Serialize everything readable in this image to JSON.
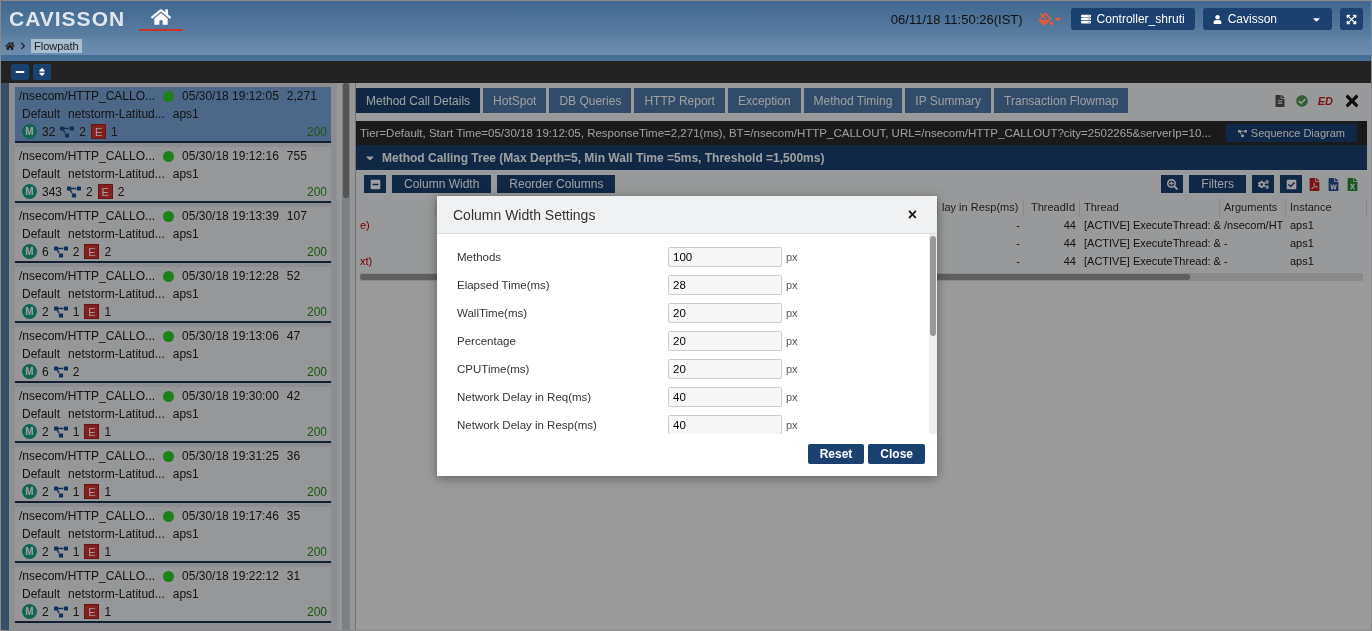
{
  "header": {
    "logo": "CAVISSON",
    "datetime": "06/11/18 11:50:26(IST)",
    "controller": "Controller_shruti",
    "user": "Cavisson"
  },
  "breadcrumb": {
    "current": "Flowpath"
  },
  "flowpaths": [
    {
      "url": "/nsecom/HTTP_CALLO...",
      "datetime": "05/30/18 19:12:05",
      "count": "2,271",
      "tier": "Default",
      "server": "netstorm-Latitud...",
      "instance": "aps1",
      "status": "200",
      "selected": true,
      "badges": [
        {
          "kind": "method",
          "label": "M",
          "count": "32"
        },
        {
          "kind": "tree",
          "count": "2"
        },
        {
          "kind": "exception",
          "label": "E",
          "count": "1"
        }
      ]
    },
    {
      "url": "/nsecom/HTTP_CALLO...",
      "datetime": "05/30/18 19:12:16",
      "count": "755",
      "tier": "Default",
      "server": "netstorm-Latitud...",
      "instance": "aps1",
      "status": "200",
      "selected": false,
      "badges": [
        {
          "kind": "method",
          "label": "M",
          "count": "343"
        },
        {
          "kind": "tree",
          "count": "2"
        },
        {
          "kind": "exception",
          "label": "E",
          "count": "2"
        }
      ]
    },
    {
      "url": "/nsecom/HTTP_CALLO...",
      "datetime": "05/30/18 19:13:39",
      "count": "107",
      "tier": "Default",
      "server": "netstorm-Latitud...",
      "instance": "aps1",
      "status": "200",
      "selected": false,
      "badges": [
        {
          "kind": "method",
          "label": "M",
          "count": "6"
        },
        {
          "kind": "tree",
          "count": "2"
        },
        {
          "kind": "exception",
          "label": "E",
          "count": "2"
        }
      ]
    },
    {
      "url": "/nsecom/HTTP_CALLO...",
      "datetime": "05/30/18 19:12:28",
      "count": "52",
      "tier": "Default",
      "server": "netstorm-Latitud...",
      "instance": "aps1",
      "status": "200",
      "selected": false,
      "badges": [
        {
          "kind": "method",
          "label": "M",
          "count": "2"
        },
        {
          "kind": "tree",
          "count": "1"
        },
        {
          "kind": "exception",
          "label": "E",
          "count": "1"
        }
      ]
    },
    {
      "url": "/nsecom/HTTP_CALLO...",
      "datetime": "05/30/18 19:13:06",
      "count": "47",
      "tier": "Default",
      "server": "netstorm-Latitud...",
      "instance": "aps1",
      "status": "200",
      "selected": false,
      "badges": [
        {
          "kind": "method",
          "label": "M",
          "count": "6"
        },
        {
          "kind": "tree",
          "count": "2"
        }
      ]
    },
    {
      "url": "/nsecom/HTTP_CALLO...",
      "datetime": "05/30/18 19:30:00",
      "count": "42",
      "tier": "Default",
      "server": "netstorm-Latitud...",
      "instance": "aps1",
      "status": "200",
      "selected": false,
      "badges": [
        {
          "kind": "method",
          "label": "M",
          "count": "2"
        },
        {
          "kind": "tree",
          "count": "1"
        },
        {
          "kind": "exception",
          "label": "E",
          "count": "1"
        }
      ]
    },
    {
      "url": "/nsecom/HTTP_CALLO...",
      "datetime": "05/30/18 19:31:25",
      "count": "36",
      "tier": "Default",
      "server": "netstorm-Latitud...",
      "instance": "aps1",
      "status": "200",
      "selected": false,
      "badges": [
        {
          "kind": "method",
          "label": "M",
          "count": "2"
        },
        {
          "kind": "tree",
          "count": "1"
        },
        {
          "kind": "exception",
          "label": "E",
          "count": "1"
        }
      ]
    },
    {
      "url": "/nsecom/HTTP_CALLO...",
      "datetime": "05/30/18 19:17:46",
      "count": "35",
      "tier": "Default",
      "server": "netstorm-Latitud...",
      "instance": "aps1",
      "status": "200",
      "selected": false,
      "badges": [
        {
          "kind": "method",
          "label": "M",
          "count": "2"
        },
        {
          "kind": "tree",
          "count": "1"
        },
        {
          "kind": "exception",
          "label": "E",
          "count": "1"
        }
      ]
    },
    {
      "url": "/nsecom/HTTP_CALLO...",
      "datetime": "05/30/18 19:22:12",
      "count": "31",
      "tier": "Default",
      "server": "netstorm-Latitud...",
      "instance": "aps1",
      "status": "200",
      "selected": false,
      "badges": [
        {
          "kind": "method",
          "label": "M",
          "count": "2"
        },
        {
          "kind": "tree",
          "count": "1"
        },
        {
          "kind": "exception",
          "label": "E",
          "count": "1"
        }
      ]
    }
  ],
  "tabs": [
    {
      "label": "Method Call Details",
      "selected": true
    },
    {
      "label": "HotSpot",
      "selected": false
    },
    {
      "label": "DB Queries",
      "selected": false
    },
    {
      "label": "HTTP Report",
      "selected": false
    },
    {
      "label": "Exception",
      "selected": false
    },
    {
      "label": "Method Timing",
      "selected": false
    },
    {
      "label": "IP Summary",
      "selected": false
    },
    {
      "label": "Transaction Flowmap",
      "selected": false
    }
  ],
  "tab_tools": {
    "ed_label": "ED"
  },
  "info_bar": {
    "text": "Tier=Default, Start Time=05/30/18 19:12:05, ResponseTime=2,271(ms), BT=/nsecom/HTTP_CALLOUT, URL=/nsecom/HTTP_CALLOUT?city=2502265&serverIp=10...",
    "button": "Sequence Diagram"
  },
  "tree_header": {
    "title": "Method Calling Tree (Max Depth=5, Min Wall Time =5ms, Threshold =1,500ms)",
    "expanded": true
  },
  "toolbar": {
    "buttons": [
      "Column Width",
      "Reorder Columns"
    ],
    "filters": "Filters"
  },
  "table": {
    "columns": [
      "lay in Resp(ms)",
      "ThreadId",
      "Thread",
      "Arguments",
      "Instance"
    ],
    "rows": [
      {
        "lead": "e)",
        "cells": [
          "-",
          "44",
          "[ACTIVE] ExecuteThread: &",
          "/nsecom/HT",
          "aps1"
        ]
      },
      {
        "cells": [
          "-",
          "44",
          "[ACTIVE] ExecuteThread: &",
          "-",
          "aps1"
        ]
      },
      {
        "lead": "xt)",
        "cells": [
          "-",
          "44",
          "[ACTIVE] ExecuteThread: &",
          "-",
          "aps1"
        ]
      }
    ]
  },
  "dialog": {
    "title": "Column Width Settings",
    "close": "×",
    "fields": [
      {
        "label": "Methods",
        "value": "100",
        "unit": "px"
      },
      {
        "label": "Elapsed Time(ms)",
        "value": "28",
        "unit": "px"
      },
      {
        "label": "WallTime(ms)",
        "value": "20",
        "unit": "px"
      },
      {
        "label": "Percentage",
        "value": "20",
        "unit": "px"
      },
      {
        "label": "CPUTime(ms)",
        "value": "20",
        "unit": "px"
      },
      {
        "label": "Network Delay in Req(ms)",
        "value": "40",
        "unit": "px"
      },
      {
        "label": "Network Delay in Resp(ms)",
        "value": "40",
        "unit": "px"
      }
    ],
    "buttons": [
      "Reset",
      "Close"
    ]
  }
}
